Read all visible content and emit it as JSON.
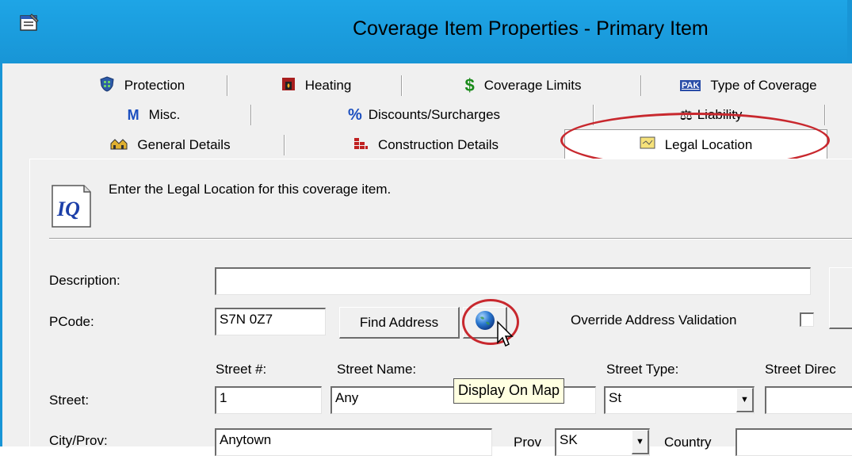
{
  "window": {
    "title": "Coverage Item Properties - Primary Item",
    "icon": "properties-icon"
  },
  "tabs": {
    "row1": [
      {
        "label": "Protection",
        "icon": "shield-icon"
      },
      {
        "label": "Heating",
        "icon": "fireplace-icon"
      },
      {
        "label": "Coverage Limits",
        "icon": "dollar-icon"
      },
      {
        "label": "Type of Coverage",
        "icon": "pak-icon"
      }
    ],
    "row2": [
      {
        "label": "Misc.",
        "icon": "m-icon"
      },
      {
        "label": "Discounts/Surcharges",
        "icon": "percent-icon"
      },
      {
        "label": "Liability",
        "icon": "scales-icon"
      }
    ],
    "row3": [
      {
        "label": "General Details",
        "icon": "houses-icon"
      },
      {
        "label": "Construction Details",
        "icon": "bricks-icon"
      },
      {
        "label": "Legal Location",
        "icon": "map-icon"
      }
    ],
    "active": "Legal Location"
  },
  "content": {
    "intro": "Enter the Legal Location for this coverage item.",
    "logo_text": "IQ",
    "description_label": "Description:",
    "description_value": "",
    "pcode_label": "PCode:",
    "pcode_value": "S7N 0Z7",
    "find_address_label": "Find Address",
    "override_label": "Override Address Validation",
    "override_checked": false,
    "tooltip": "Display On Map",
    "street_label": "Street:",
    "street_num_label": "Street #:",
    "street_num_value": "1",
    "street_name_label": "Street  Name:",
    "street_name_value": "Any",
    "street_type_label": "Street Type:",
    "street_type_value": "St",
    "street_dir_label": "Street Direc",
    "city_label": "City/Prov:",
    "city_value": "Anytown",
    "prov_label": "Prov",
    "prov_value": "SK",
    "country_label": "Country"
  },
  "colors": {
    "titlebar": "#1895d6",
    "highlight_ring": "#c8282e"
  }
}
